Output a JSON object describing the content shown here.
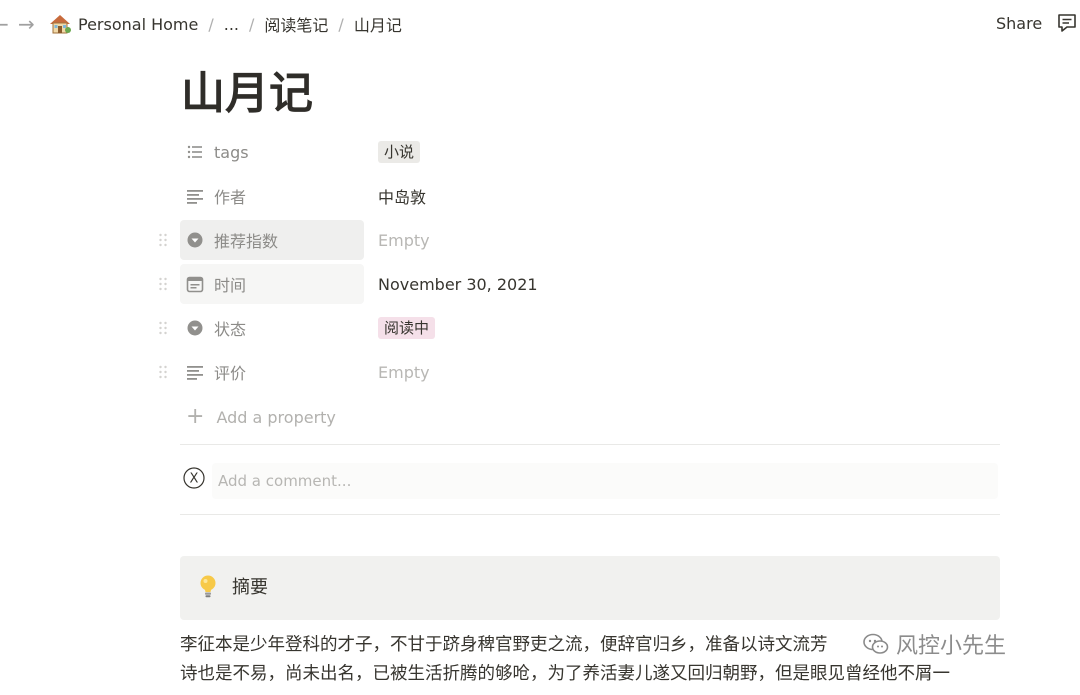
{
  "breadcrumb": {
    "workspace": "Personal Home",
    "ellipsis": "...",
    "parent": "阅读笔记",
    "current": "山月记"
  },
  "topbar": {
    "share_label": "Share"
  },
  "page": {
    "title": "山月记"
  },
  "properties": [
    {
      "name": "tags",
      "icon": "list-icon",
      "value": "小说",
      "kind": "tag",
      "tag_color": "#ebeae7"
    },
    {
      "name": "作者",
      "icon": "text-icon",
      "value": "中岛敦",
      "kind": "text"
    },
    {
      "name": "推荐指数",
      "icon": "select-icon",
      "value": "Empty",
      "kind": "empty"
    },
    {
      "name": "时间",
      "icon": "calendar-icon",
      "value": "November 30, 2021",
      "kind": "text"
    },
    {
      "name": "状态",
      "icon": "select-icon",
      "value": "阅读中",
      "kind": "tag",
      "tag_color": "#f5e0e9"
    },
    {
      "name": "评价",
      "icon": "text-icon",
      "value": "Empty",
      "kind": "empty"
    }
  ],
  "add_property_label": "Add a property",
  "comment": {
    "avatar_letter": "X",
    "placeholder": "Add a comment..."
  },
  "callout": {
    "icon": "lightbulb-icon",
    "text": "摘要"
  },
  "body": {
    "lines": [
      "李征本是少年登科的才子，不甘于跻身稗官野吏之流，便辞官归乡，准备以诗文流芳",
      "诗也是不易，尚未出名，已被生活折腾的够呛，为了养活妻儿遂又回归朝野，但是眼见曾经他不屑一"
    ]
  },
  "watermark": {
    "text": "风控小先生"
  }
}
